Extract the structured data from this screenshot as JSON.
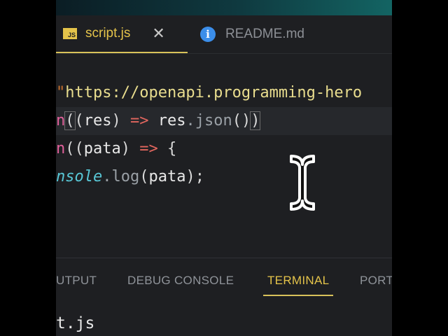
{
  "tabs": [
    {
      "label": "script.js",
      "badge": "JS",
      "icon": "js-file-icon",
      "close": "✕"
    },
    {
      "label": "README.md",
      "icon": "info-icon"
    }
  ],
  "code": {
    "line1": {
      "q": "\"",
      "url": "https://openapi.programming-hero"
    },
    "line2": {
      "pre": "n",
      "open": "(",
      "p2": "(",
      "res": "res",
      "p3": ")",
      "arrow": " => ",
      "body": "res",
      "dot": ".",
      "json": "json",
      "call": "()",
      "close": ")"
    },
    "line3": {
      "pre": "n",
      "open": "((",
      "pata": "pata",
      "p3": ")",
      "arrow": " => ",
      "brace": "{"
    },
    "line4": {
      "nsole": "nsole",
      "dot": ".",
      "log": "log",
      "open": "(",
      "pata": "pata",
      "close": ");"
    }
  },
  "panel": {
    "tabs": [
      "UTPUT",
      "DEBUG CONSOLE",
      "TERMINAL",
      "PORT"
    ],
    "terminal_text": "t.js"
  },
  "colors": {
    "accent": "#e4c34a",
    "string": "#e9dd8e",
    "keyword": "#e0609a",
    "arrow": "#e2665e"
  }
}
